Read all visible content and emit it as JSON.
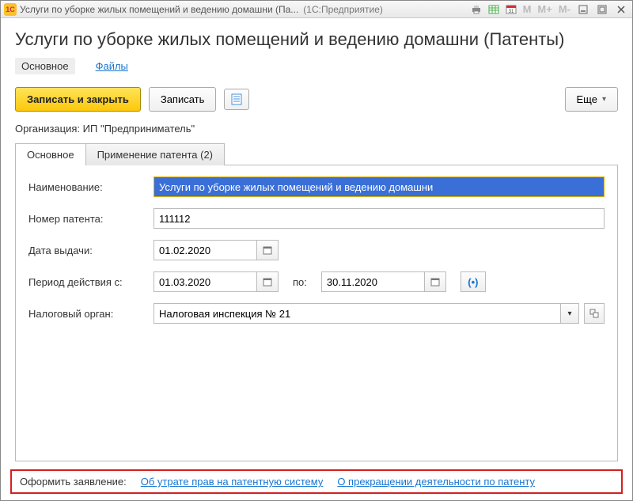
{
  "titlebar": {
    "logo": "1C",
    "title": "Услуги по уборке жилых помещений и ведению домашни (Па...",
    "suffix": "(1С:Предприятие)",
    "mem": {
      "m": "M",
      "mp": "M+",
      "mm": "M-"
    }
  },
  "header": {
    "title": "Услуги по уборке жилых помещений и ведению домашни (Патенты)"
  },
  "nav": {
    "main": "Основное",
    "files": "Файлы"
  },
  "toolbar": {
    "save_close": "Записать и закрыть",
    "save": "Записать",
    "more": "Еще"
  },
  "org": {
    "label": "Организация:",
    "value": "ИП \"Предприниматель\""
  },
  "tabs": {
    "main": "Основное",
    "patent": "Применение патента (2)"
  },
  "form": {
    "name_label": "Наименование:",
    "name_value": "Услуги по уборке жилых помещений и ведению домашни",
    "number_label": "Номер патента:",
    "number_value": "111112",
    "issue_date_label": "Дата выдачи:",
    "issue_date_value": "01.02.2020",
    "period_from_label": "Период действия с:",
    "period_from_value": "01.03.2020",
    "period_to_label": "по:",
    "period_to_value": "30.11.2020",
    "bracket": "(•)",
    "tax_label": "Налоговый орган:",
    "tax_value": "Налоговая инспекция № 21"
  },
  "footer": {
    "label": "Оформить заявление:",
    "link1": "Об утрате прав на патентную систему",
    "link2": "О прекращении деятельности по патенту"
  }
}
